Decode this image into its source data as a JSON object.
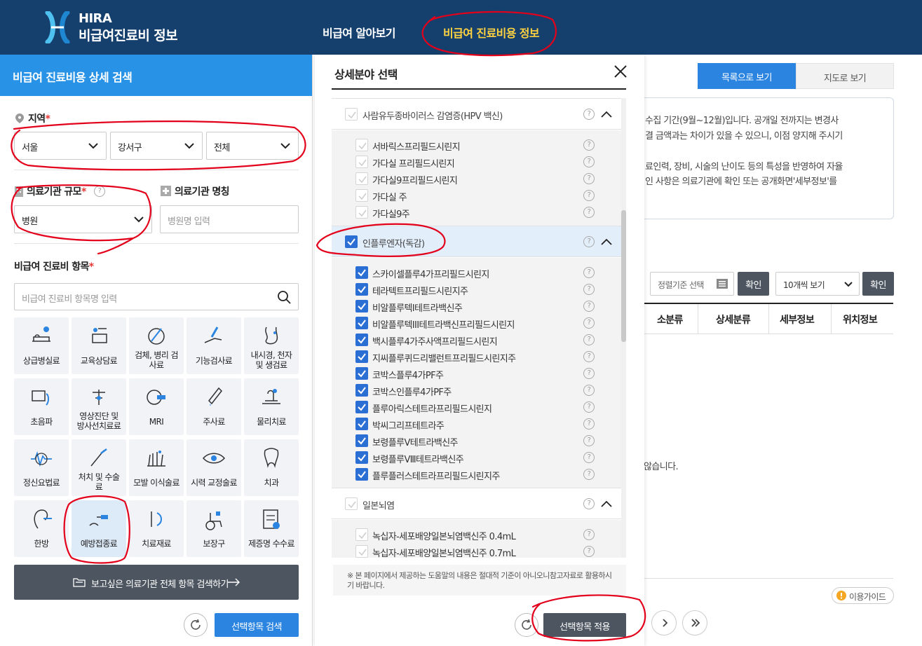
{
  "header": {
    "logo_top": "HIRA",
    "logo_bottom": "비급여진료비 정보",
    "nav": [
      "비급여 알아보기",
      "비급여 진료비용 정보"
    ]
  },
  "left": {
    "title": "비급여 진료비용 상세 검색",
    "region_label": "지역",
    "region": {
      "sido": "서울",
      "sigungu": "강서구",
      "dong": "전체"
    },
    "scale_label": "의료기관 규모",
    "scale_value": "병원",
    "name_label": "의료기관 명칭",
    "name_placeholder": "병원명 입력",
    "item_label": "비급여 진료비 항목",
    "item_placeholder": "비급여 진료비 항목명 입력",
    "categories": [
      "상급병실료",
      "교육상담료",
      "검체, 병리 검사료",
      "기능검사료",
      "내시경, 천자 및 생검료",
      "초음파",
      "영상진단 및 방사선치료료",
      "MRI",
      "주사료",
      "물리치료",
      "정신요법료",
      "처치 및 수술료",
      "모발 이식술료",
      "시력 교정술료",
      "치과",
      "한방",
      "예방접종료",
      "치료재료",
      "보장구",
      "제증명 수수료"
    ],
    "search_all": "보고싶은 의료기관 전체 항목 검색하기",
    "search_btn": "선택항목 검색"
  },
  "modal": {
    "title": "상세분야 선택",
    "groups": [
      {
        "label": "사람유두종바이러스 감염증(HPV 백신)",
        "checked": false,
        "items": [
          "서바릭스프리필드시린지",
          "가다실 프리필드시린지",
          "가다실9프리필드시린지",
          "가다실 주",
          "가다실9주"
        ]
      },
      {
        "label": "인플루엔자(독감)",
        "checked": true,
        "items": [
          "스카이셀플루4가프리필드시린지",
          "테라텍트프리필드시린지주",
          "비알플루텍I테트라백신주",
          "비알플루텍III테트라백신프리필드시린지",
          "백시플루4가주사액프리필드시린지",
          "지씨플루퀴드리밸런트프리필드시린지주",
          "코박스플루4가PF주",
          "코박스인플루4가PF주",
          "플루아릭스테트라프리필드시린지",
          "박씨그리프테트라주",
          "보령플루Ⅴ테트라백신주",
          "보령플루Ⅷ테트라백신주",
          "플루플러스테트라프리필드시린지주"
        ]
      },
      {
        "label": "일본뇌염",
        "checked": false,
        "items": [
          "녹십자-세포배양일본뇌염백신주 0.4mL",
          "녹십자-세포배양일본뇌염백신주 0.7mL"
        ]
      }
    ],
    "note": "※ 본 페이지에서 제공하는 도움말의 내용은 절대적 기준이 아니오니참고자료로 활용하시기 바랍니다.",
    "apply": "선택항목 적용"
  },
  "right": {
    "tab_list": "목록으로 보기",
    "tab_map": "지도로 보기",
    "notice_lines": [
      "수집 기간(9월~12월)입니다. 공개일 전까지는 변경사",
      "결 금액과는 차이가 있을 수 있으니, 이점 양지해 주시기",
      "",
      "료인력, 장비, 시술의 난이도 등의 특성을 반영하여 자율",
      "인 사항은 의료기관에 확인 또는 공개화면'세부정보'를"
    ],
    "sort_placeholder": "정렬기준 선택",
    "confirm": "확인",
    "view_count": "10개씩 보기",
    "columns": [
      "소분류",
      "상세분류",
      "세부정보",
      "위치정보"
    ],
    "nodata": "않습니다.",
    "guide": "이용가이드"
  },
  "colors": {
    "header_bg": "#15406e",
    "accent": "#2b85e0",
    "nav_active": "#ffd23f",
    "annotation": "#e3001b"
  }
}
